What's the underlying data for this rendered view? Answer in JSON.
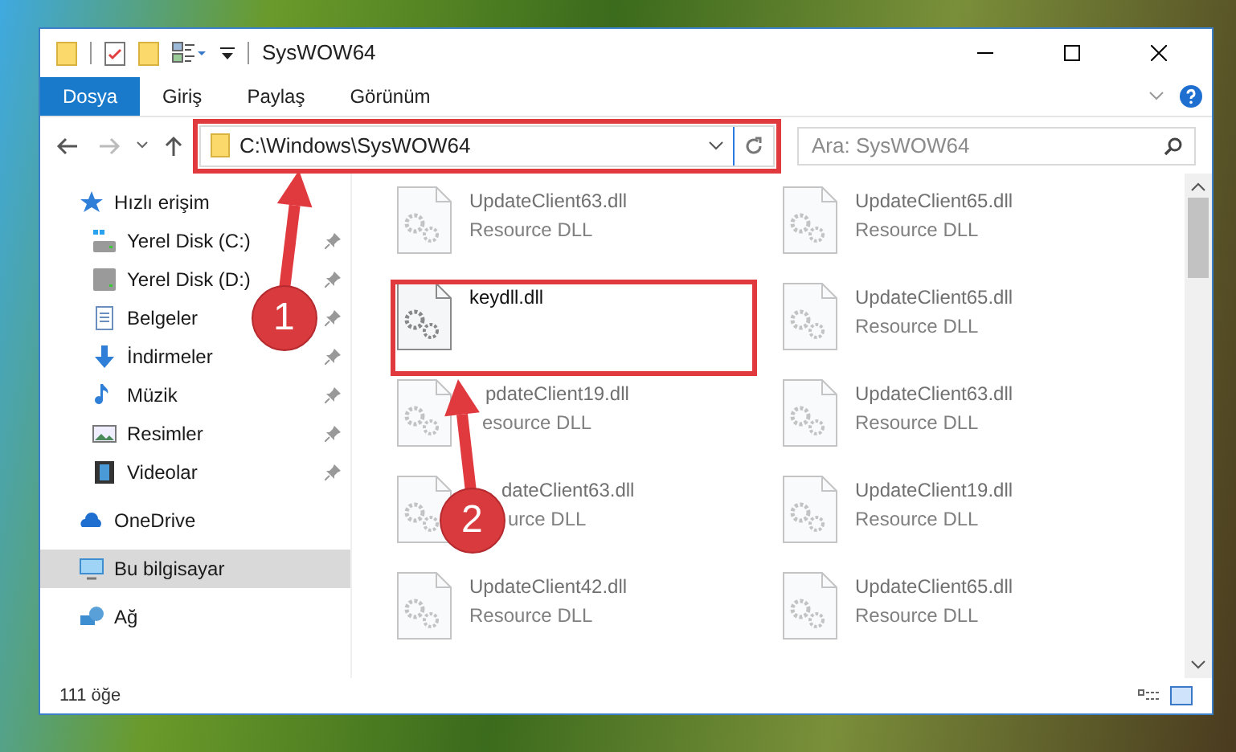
{
  "window": {
    "title": "SysWOW64"
  },
  "ribbon_tabs": [
    {
      "label": "Dosya",
      "selected": true
    },
    {
      "label": "Giriş",
      "selected": false
    },
    {
      "label": "Paylaş",
      "selected": false
    },
    {
      "label": "Görünüm",
      "selected": false
    }
  ],
  "address": {
    "path": "C:\\Windows\\SysWOW64"
  },
  "search": {
    "placeholder": "Ara: SysWOW64"
  },
  "sidebar": {
    "items": [
      {
        "label": "Hızlı erişim",
        "kind": "star",
        "selected": false,
        "children": [
          {
            "label": "Yerel Disk (C:)",
            "kind": "windrive",
            "pinned": true,
            "selected": false
          },
          {
            "label": "Yerel Disk (D:)",
            "kind": "drive",
            "pinned": true,
            "selected": false
          },
          {
            "label": "Belgeler",
            "kind": "doc",
            "pinned": true,
            "selected": false
          },
          {
            "label": "İndirmeler",
            "kind": "download",
            "pinned": true,
            "selected": false
          },
          {
            "label": "Müzik",
            "kind": "music",
            "pinned": true,
            "selected": false
          },
          {
            "label": "Resimler",
            "kind": "picture",
            "pinned": true,
            "selected": false
          },
          {
            "label": "Videolar",
            "kind": "video",
            "pinned": true,
            "selected": false
          }
        ]
      },
      {
        "label": "OneDrive",
        "kind": "cloud",
        "selected": false
      },
      {
        "label": "Bu bilgisayar",
        "kind": "computer",
        "selected": true
      },
      {
        "label": "Ağ",
        "kind": "network",
        "selected": false
      }
    ]
  },
  "files": [
    {
      "name": "UpdateClient63.dll",
      "type": "Resource DLL",
      "faded": true
    },
    {
      "name": "UpdateClient65.dll",
      "type": "Resource DLL",
      "faded": true
    },
    {
      "name": "keydll.dll",
      "faded": false
    },
    {
      "name": "UpdateClient65.dll",
      "type": "Resource DLL",
      "faded": true
    },
    {
      "name": "pdateClient19.dll",
      "type": "esource DLL",
      "faded": true
    },
    {
      "name": "UpdateClient63.dll",
      "type": "Resource DLL",
      "faded": true
    },
    {
      "name": "dateClient63.dll",
      "type": "urce DLL",
      "faded": true
    },
    {
      "name": "UpdateClient19.dll",
      "type": "Resource DLL",
      "faded": true
    },
    {
      "name": "UpdateClient42.dll",
      "type": "Resource DLL",
      "faded": true
    },
    {
      "name": "UpdateClient65.dll",
      "type": "Resource DLL",
      "faded": true
    }
  ],
  "status_bar": {
    "count": "111 öğe"
  },
  "annotations": [
    {
      "number": "1"
    },
    {
      "number": "2"
    }
  ]
}
